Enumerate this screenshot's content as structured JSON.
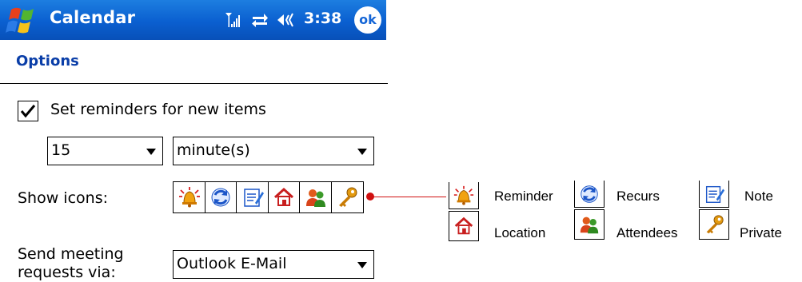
{
  "titlebar": {
    "app_title": "Calendar",
    "clock": "3:38",
    "ok_label": "ok",
    "background": "#0a5fd0"
  },
  "page": {
    "heading": "Options"
  },
  "reminders": {
    "checkbox_label": "Set reminders for new items",
    "checked": true,
    "amount_value": "15",
    "unit_value": "minute(s)"
  },
  "show_icons": {
    "label": "Show icons:",
    "icons": [
      "alarm-bell-icon",
      "recurring-arrows-icon",
      "note-icon",
      "home-icon",
      "attendees-icon",
      "key-icon"
    ]
  },
  "send_meeting": {
    "label_line1": "Send meeting",
    "label_line2": "requests via:",
    "value": "Outlook E-Mail"
  },
  "legend": {
    "reminder": "Reminder",
    "recurs": "Recurs",
    "note": "Note",
    "location": "Location",
    "attendees": "Attendees",
    "private": "Private"
  }
}
